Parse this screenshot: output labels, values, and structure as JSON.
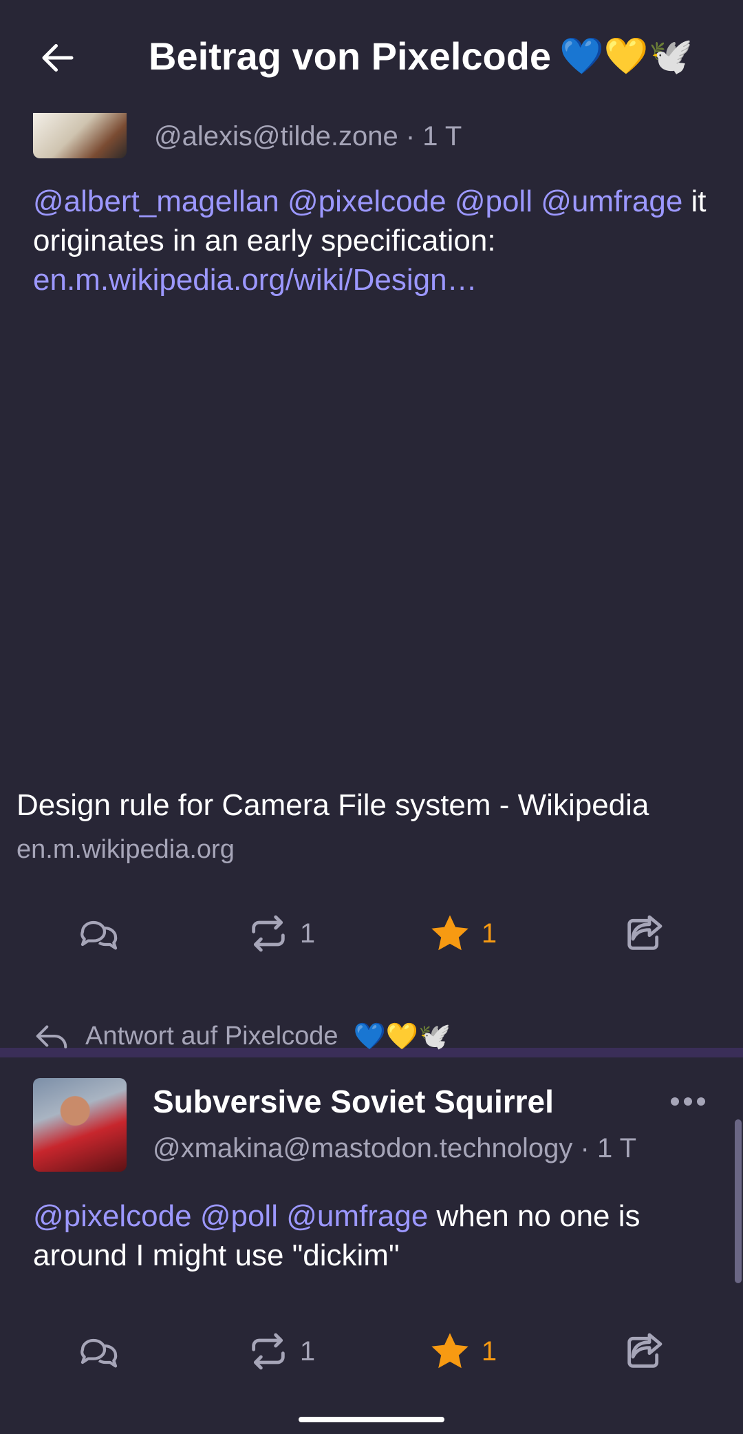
{
  "header": {
    "title": "Beitrag von Pixelcode",
    "title_emoji": "💙💛🕊️"
  },
  "post1": {
    "handle": "@alexis@tilde.zone · 1 T",
    "text": {
      "mentions": [
        "@albert_magellan",
        "@pixelcode",
        "@poll",
        "@umfrage"
      ],
      "plain": "it originates in an early specification:",
      "link": "en.m.wikipedia.org/wiki/Design…"
    },
    "card": {
      "title": "Design rule for Camera File system - Wikipedia",
      "domain": "en.m.wikipedia.org"
    },
    "actions": {
      "reblogs": "1",
      "favourites": "1"
    }
  },
  "reply": {
    "label": "Antwort auf Pixelcode",
    "emoji": "💙💛🕊️"
  },
  "post2": {
    "display_name": "Subversive Soviet Squirrel",
    "handle": "@xmakina@mastodon.technology · 1 T",
    "text": {
      "mentions": [
        "@pixelcode",
        "@poll",
        "@umfrage"
      ],
      "plain": "when no one is around I might use \"dickim\""
    },
    "actions": {
      "reblogs": "1",
      "favourites": "1"
    }
  },
  "colors": {
    "background": "#282636",
    "accent": "#9c98ff",
    "favourite": "#f79a12",
    "muted": "#a6a5b8"
  },
  "icons": [
    "back-arrow-icon",
    "reply-icon",
    "boost-icon",
    "star-icon",
    "share-icon",
    "reply-arrow-icon",
    "more-icon"
  ]
}
